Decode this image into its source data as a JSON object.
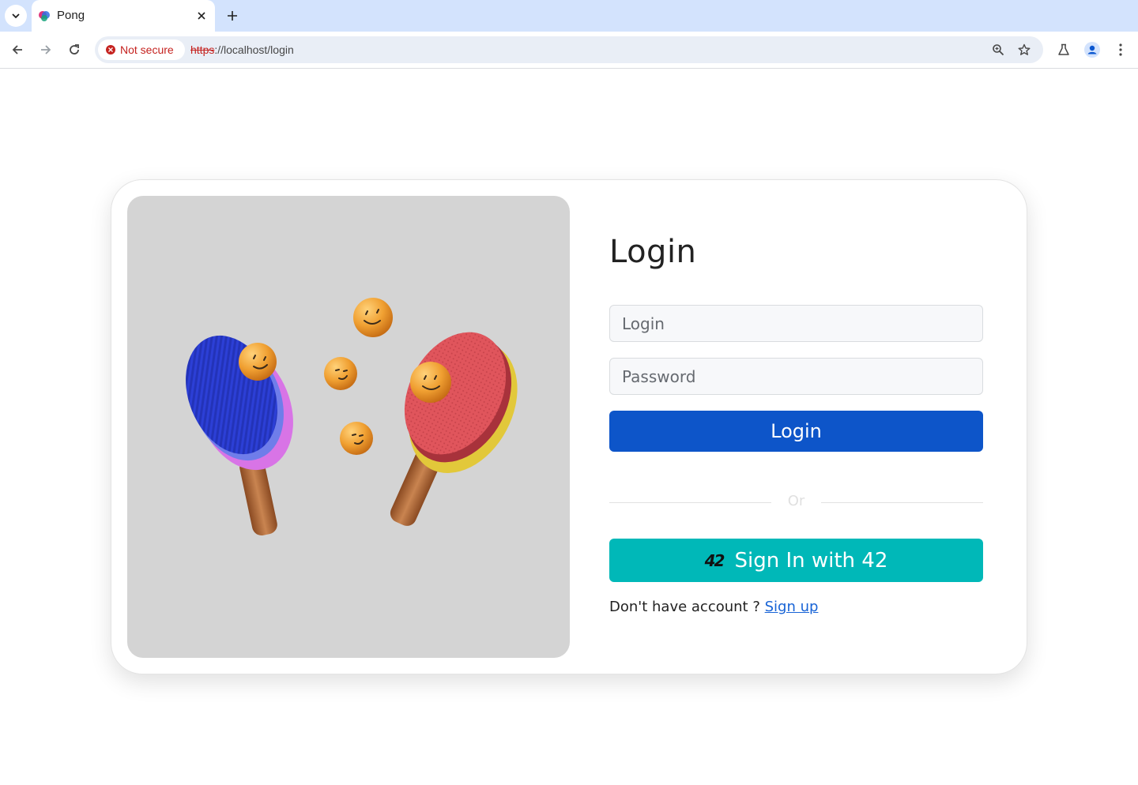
{
  "browser": {
    "tab_title": "Pong",
    "security_label": "Not secure",
    "url_scheme": "https",
    "url_rest": "://localhost/login"
  },
  "icons": {
    "tab_menu": "chevron-down-icon",
    "favicon": "pong-favicon-icon",
    "tab_close": "close-icon",
    "new_tab": "plus-icon",
    "back": "arrow-left-icon",
    "forward": "arrow-right-icon",
    "reload": "reload-icon",
    "security": "error-circle-icon",
    "zoom": "zoom-icon",
    "bookmark": "star-icon",
    "labs": "flask-icon",
    "profile": "profile-icon",
    "menu": "kebab-menu-icon",
    "school": "logo-42-icon"
  },
  "login": {
    "heading": "Login",
    "login_placeholder": "Login",
    "password_placeholder": "Password",
    "submit_label": "Login",
    "divider_text": "Or",
    "oauth_label": "Sign In with 42",
    "oauth_logo": "42",
    "signup_prompt": "Don't have account ? ",
    "signup_link": "Sign up"
  },
  "colors": {
    "primary": "#0d55c9",
    "oauth": "#00b8b8",
    "link": "#1763d6",
    "hero_bg": "#d4d4d4",
    "insecure": "#c5221f"
  }
}
